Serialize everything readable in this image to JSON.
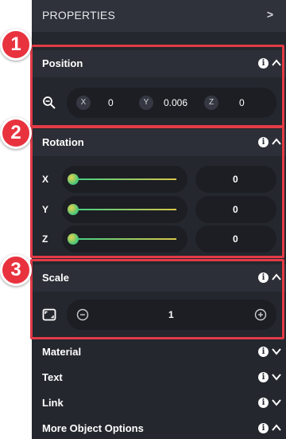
{
  "panel": {
    "title": "PROPERTIES",
    "expand_glyph": ">"
  },
  "position": {
    "label": "Position",
    "axis_x": "X",
    "value_x": "0",
    "axis_y": "Y",
    "value_y": "0.006",
    "axis_z": "Z",
    "value_z": "0"
  },
  "rotation": {
    "label": "Rotation",
    "rows": [
      {
        "axis": "X",
        "value": "0",
        "level": 0
      },
      {
        "axis": "Y",
        "value": "0",
        "level": 0
      },
      {
        "axis": "Z",
        "value": "0",
        "level": 0
      }
    ]
  },
  "scale": {
    "label": "Scale",
    "value": "1"
  },
  "collapsed_sections": [
    {
      "label": "Material"
    },
    {
      "label": "Text"
    },
    {
      "label": "Link"
    },
    {
      "label": "More Object Options"
    }
  ],
  "callouts": [
    "1",
    "2",
    "3"
  ],
  "icons": {
    "info": "info-icon",
    "caret_up": "chevron-up-icon",
    "caret_down": "chevron-down-icon",
    "zoom": "zoom-out-icon",
    "scale_frame": "frame-icon",
    "minus": "minus-circle-icon",
    "plus": "plus-circle-icon"
  },
  "colors": {
    "panel_bg": "#24272e",
    "header_bg": "#2c2f37",
    "pill_bg": "#1c1e23",
    "highlight": "#e23b46",
    "slider_start": "#3fcf87",
    "slider_end": "#d9c64a"
  }
}
